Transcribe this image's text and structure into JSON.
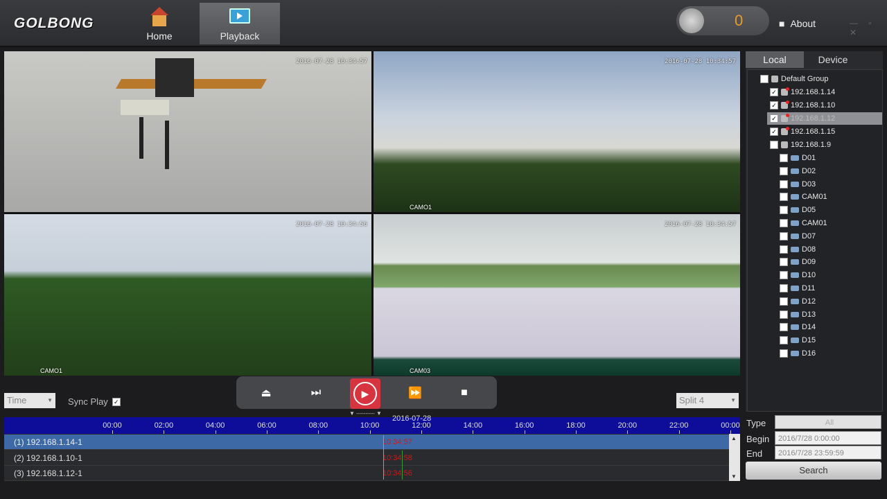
{
  "header": {
    "logo": "GOLBONG",
    "nav": [
      {
        "label": "Home"
      },
      {
        "label": "Playback"
      }
    ],
    "alarm_count": "0",
    "about_label": "About"
  },
  "cameras": [
    {
      "timestamp": "2016-07-28 10:34:57",
      "name": ""
    },
    {
      "timestamp": "2016-07-28 10:34:57",
      "name": "CAMO1"
    },
    {
      "timestamp": "2016-07-28 10:34:56",
      "name": "CAMO1"
    },
    {
      "timestamp": "2016-07-28 10:34:57",
      "name": "CAM03"
    }
  ],
  "sidebar": {
    "tabs": [
      "Local",
      "Device"
    ],
    "group": "Default Group",
    "devices": [
      {
        "label": "192.168.1.14",
        "checked": true
      },
      {
        "label": "192.168.1.10",
        "checked": true
      },
      {
        "label": "192.168.1.12",
        "checked": true
      },
      {
        "label": "192.168.1.15",
        "checked": true
      },
      {
        "label": "192.168.1.9",
        "checked": false
      }
    ],
    "channels": [
      "D01",
      "D02",
      "D03",
      "CAM01",
      "D05",
      "CAM01",
      "D07",
      "D08",
      "D09",
      "D10",
      "D11",
      "D12",
      "D13",
      "D14",
      "D15",
      "D16"
    ]
  },
  "controls": {
    "time_select": "Time",
    "sync_play": "Sync Play",
    "split_select": "Split 4"
  },
  "timeline": {
    "date": "2016-07-28",
    "ticks": [
      "00:00",
      "02:00",
      "04:00",
      "06:00",
      "08:00",
      "10:00",
      "12:00",
      "14:00",
      "16:00",
      "18:00",
      "20:00",
      "22:00",
      "00:00"
    ],
    "rows": [
      {
        "label": "(1) 192.168.1.14-1",
        "time": "10:34:57"
      },
      {
        "label": "(2) 192.168.1.10-1",
        "time": "10:34:58"
      },
      {
        "label": "(3) 192.168.1.12-1",
        "time": "10:34:56"
      }
    ]
  },
  "search": {
    "type_label": "Type",
    "type_value": "All",
    "begin_label": "Begin",
    "begin_value": "2016/7/28 0:00:00",
    "end_label": "End",
    "end_value": "2016/7/28 23:59:59",
    "button": "Search"
  }
}
